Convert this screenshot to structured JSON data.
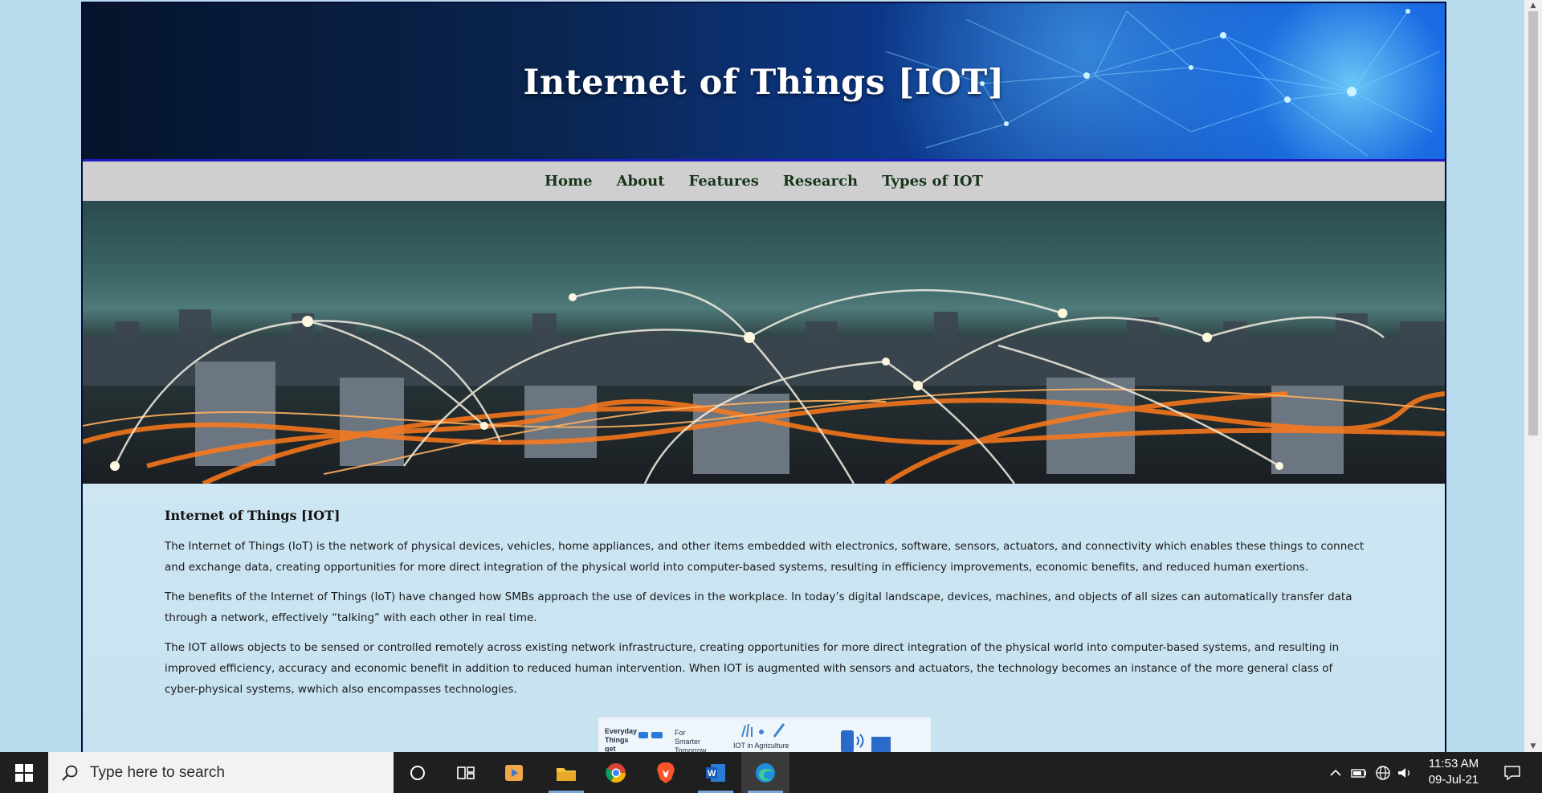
{
  "banner": {
    "title": "Internet of Things [IOT]"
  },
  "nav": {
    "items": [
      "Home",
      "About",
      "Features",
      "Research",
      "Types of IOT"
    ]
  },
  "content": {
    "heading": "Internet of Things [IOT]",
    "paragraphs": [
      "The Internet of Things (IoT) is the network of physical devices, vehicles, home appliances, and other items embedded with electronics, software, sensors, actuators, and connectivity which enables these things to connect and exchange data, creating opportunities for more direct integration of the physical world into computer-based systems, resulting in efficiency improvements, economic benefits, and reduced human exertions.",
      "The benefits of the Internet of Things (IoT) have changed how SMBs approach the use of devices in the workplace. In today’s digital landscape, devices, machines, and objects of all sizes can automatically transfer data through a network, effectively “talking” with each other in real time.",
      "The IOT allows objects to be sensed or controlled remotely across existing network infrastructure, creating opportunities for more direct integration of the physical world into computer-based systems, and resulting in improved efficiency, accuracy and economic benefit in addition to reduced human intervention. When IOT is augmented with sensors and actuators, the technology becomes an instance of the more general class of cyber-physical systems, wwhich also encompasses technologies."
    ],
    "thumbnail_labels": [
      "Everyday Things get connected",
      "For Smarter Tomorrow",
      "IOT in Agriculture"
    ]
  },
  "taskbar": {
    "search_placeholder": "Type here to search",
    "time": "11:53 AM",
    "date": "09-Jul-21",
    "icons": [
      "windows-start-icon",
      "cortana-icon",
      "task-view-icon",
      "media-player-icon",
      "file-explorer-icon",
      "chrome-icon",
      "brave-icon",
      "word-icon",
      "edge-icon"
    ]
  },
  "colors": {
    "banner_blue": "#0b48c4",
    "nav_bg": "#cfcfcf",
    "nav_text": "#17361a",
    "page_bg": "#b9dcee",
    "taskbar": "#1f1f1f"
  }
}
